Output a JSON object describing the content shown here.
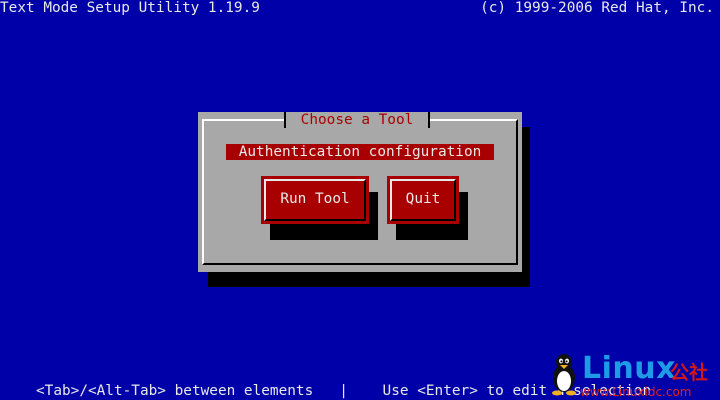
{
  "header": {
    "title": "Text Mode Setup Utility 1.19.9",
    "copyright": "(c) 1999-2006 Red Hat, Inc."
  },
  "dialog": {
    "title": "Choose a Tool",
    "list_items": [
      "Authentication configuration"
    ],
    "buttons": {
      "run_tool": "Run Tool",
      "quit": "Quit"
    }
  },
  "help_line": "<Tab>/<Alt-Tab> between elements   |    Use <Enter> to edit a selection",
  "watermark": {
    "brand": "Linux",
    "suffix": "公社",
    "url": "www.Linuxidc.com",
    "icon": "tux-penguin-icon"
  },
  "colors": {
    "background": "#0000a8",
    "dialog": "#a8a8a8",
    "accent": "#a80000",
    "text": "#e8e8e8"
  }
}
